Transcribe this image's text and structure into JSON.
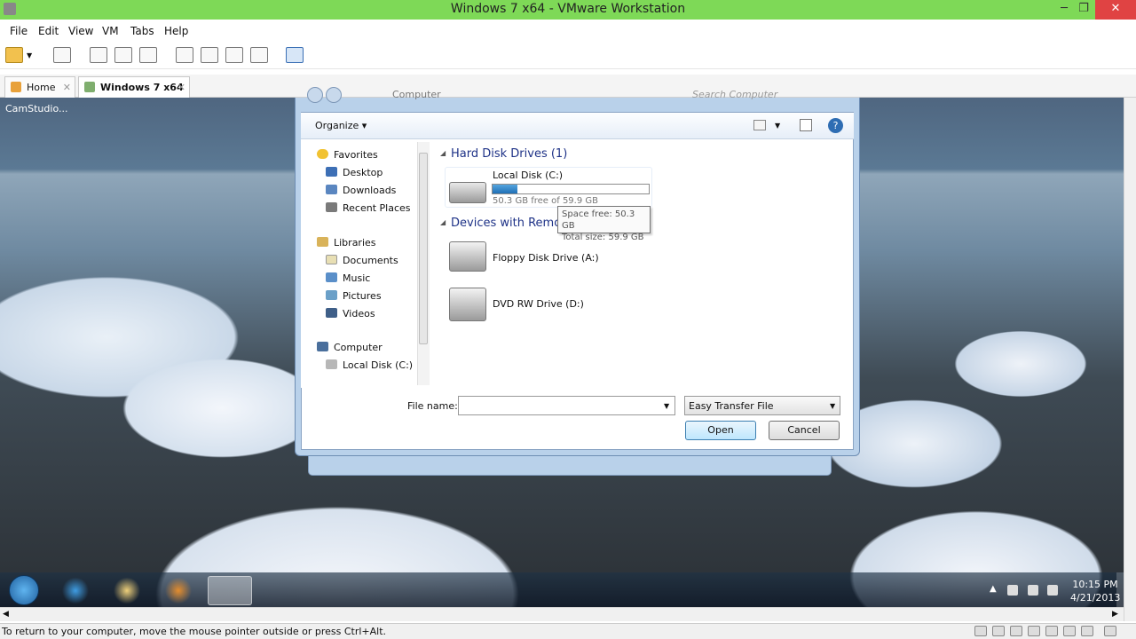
{
  "window": {
    "title": "Windows 7 x64 - VMware Workstation",
    "minimize": "─",
    "restore": "❐",
    "close": "✕"
  },
  "menu": [
    "File",
    "Edit",
    "View",
    "VM",
    "Tabs",
    "Help"
  ],
  "tabs": [
    {
      "label": "Home",
      "close": "✕"
    },
    {
      "label": "Windows 7 x64",
      "close": "✕"
    }
  ],
  "overlay": {
    "recorder": "CamStudio..."
  },
  "dialog": {
    "address_crumb": "Computer",
    "search_placeholder": "Search Computer",
    "organize": "Organize ▾",
    "nav": {
      "favorites": "Favorites",
      "fav_items": [
        "Desktop",
        "Downloads",
        "Recent Places"
      ],
      "libraries": "Libraries",
      "lib_items": [
        "Documents",
        "Music",
        "Pictures",
        "Videos"
      ],
      "computer": "Computer",
      "comp_items": [
        "Local Disk (C:)"
      ]
    },
    "sections": {
      "hdd": "Hard Disk Drives (1)",
      "removable": "Devices with Remo"
    },
    "local_disk": {
      "name": "Local Disk (C:)",
      "free_text": "50.3 GB free of 59.9 GB",
      "used_fraction": 0.16
    },
    "tooltip": {
      "line1": "Space free: 50.3 GB",
      "line2": "Total size: 59.9 GB"
    },
    "devices": [
      "Floppy Disk Drive (A:)",
      "DVD RW Drive (D:)"
    ],
    "file_name_label": "File name:",
    "file_name_value": "",
    "file_type": "Easy Transfer File",
    "open": "Open",
    "cancel": "Cancel"
  },
  "clock": {
    "time": "10:15 PM",
    "date": "4/21/2013"
  },
  "status": "To return to your computer, move the mouse pointer outside or press Ctrl+Alt.",
  "colors": {
    "titlebar": "#7ed957",
    "close": "#e04343",
    "link_blue": "#1e3287"
  }
}
